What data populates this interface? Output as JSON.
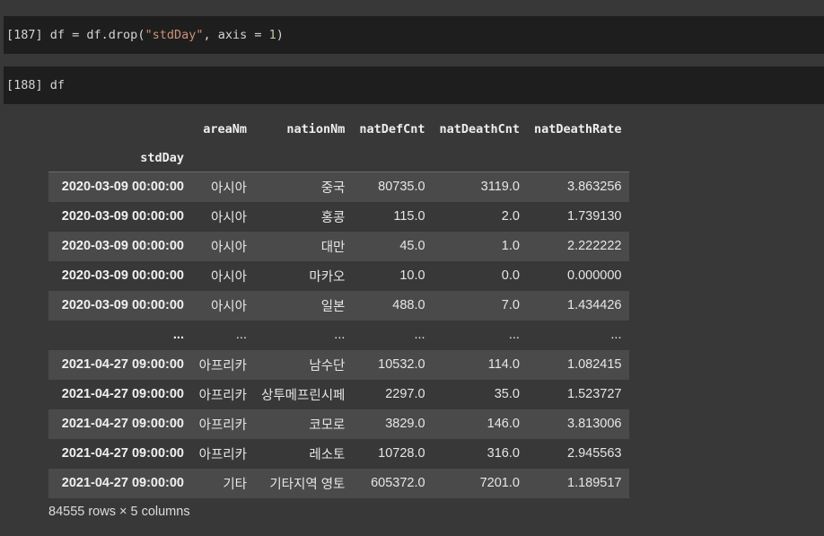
{
  "cells": [
    {
      "prompt": "[187]",
      "code_before": "df = df.drop(",
      "code_string": "\"stdDay\"",
      "code_middle": ", axis = ",
      "code_number": "1",
      "code_after": ")"
    },
    {
      "prompt": "[188]",
      "code": "df"
    }
  ],
  "dataframe": {
    "columns": [
      "areaNm",
      "nationNm",
      "natDefCnt",
      "natDeathCnt",
      "natDeathRate"
    ],
    "index_name": "stdDay",
    "rows": [
      {
        "index": "2020-03-09 00:00:00",
        "values": [
          "아시아",
          "중국",
          "80735.0",
          "3119.0",
          "3.863256"
        ]
      },
      {
        "index": "2020-03-09 00:00:00",
        "values": [
          "아시아",
          "홍콩",
          "115.0",
          "2.0",
          "1.739130"
        ]
      },
      {
        "index": "2020-03-09 00:00:00",
        "values": [
          "아시아",
          "대만",
          "45.0",
          "1.0",
          "2.222222"
        ]
      },
      {
        "index": "2020-03-09 00:00:00",
        "values": [
          "아시아",
          "마카오",
          "10.0",
          "0.0",
          "0.000000"
        ]
      },
      {
        "index": "2020-03-09 00:00:00",
        "values": [
          "아시아",
          "일본",
          "488.0",
          "7.0",
          "1.434426"
        ]
      },
      {
        "index": "...",
        "values": [
          "...",
          "...",
          "...",
          "...",
          "..."
        ]
      },
      {
        "index": "2021-04-27 09:00:00",
        "values": [
          "아프리카",
          "남수단",
          "10532.0",
          "114.0",
          "1.082415"
        ]
      },
      {
        "index": "2021-04-27 09:00:00",
        "values": [
          "아프리카",
          "상투메프린시페",
          "2297.0",
          "35.0",
          "1.523727"
        ]
      },
      {
        "index": "2021-04-27 09:00:00",
        "values": [
          "아프리카",
          "코모로",
          "3829.0",
          "146.0",
          "3.813006"
        ]
      },
      {
        "index": "2021-04-27 09:00:00",
        "values": [
          "아프리카",
          "레소토",
          "10728.0",
          "316.0",
          "2.945563"
        ]
      },
      {
        "index": "2021-04-27 09:00:00",
        "values": [
          "기타",
          "기타지역 영토",
          "605372.0",
          "7201.0",
          "1.189517"
        ]
      }
    ],
    "shape_note": "84555 rows × 5 columns"
  },
  "colors": {
    "background": "#383838",
    "cell_background": "#1e1e1e",
    "string_token": "#ce9178",
    "number_token": "#b5cea8",
    "row_stripe": "#4a4a4a"
  }
}
